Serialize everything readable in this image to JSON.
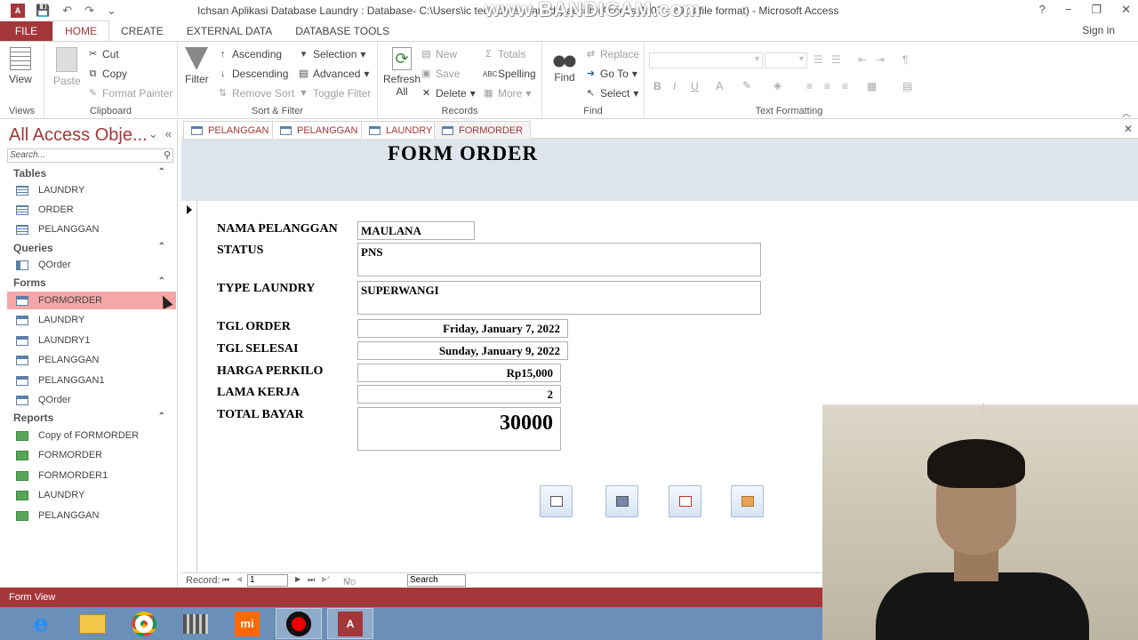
{
  "window": {
    "title": "Ichsan Aplikasi Database Laundry : Database- C:\\Users\\ic tech           dbase laundry.accdb (Access 2007 - 2013 file format) - Microsoft Access",
    "watermark": "www.BANDICAM.com",
    "app_icon": "A",
    "help": "?",
    "minimize": "−",
    "restore": "❐",
    "close": "✕",
    "qat_save": "💾",
    "qat_undo": "↶",
    "qat_redo": "↷",
    "qat_more": "⌄"
  },
  "ribbon_tabs": {
    "file": "FILE",
    "tabs": [
      "HOME",
      "CREATE",
      "EXTERNAL DATA",
      "DATABASE TOOLS"
    ],
    "active": "HOME",
    "signin": "Sign in"
  },
  "ribbon": {
    "views": {
      "label": "Views",
      "view": "View"
    },
    "clipboard": {
      "label": "Clipboard",
      "paste": "Paste",
      "cut": "Cut",
      "copy": "Copy",
      "format_painter": "Format Painter"
    },
    "sort_filter": {
      "label": "Sort & Filter",
      "filter": "Filter",
      "ascending": "Ascending",
      "descending": "Descending",
      "remove_sort": "Remove Sort",
      "selection": "Selection",
      "advanced": "Advanced",
      "toggle_filter": "Toggle Filter"
    },
    "records": {
      "label": "Records",
      "refresh": "Refresh",
      "refresh_all": "All",
      "new": "New",
      "save": "Save",
      "delete": "Delete",
      "totals": "Totals",
      "spelling": "Spelling",
      "more": "More"
    },
    "find": {
      "label": "Find",
      "find": "Find",
      "replace": "Replace",
      "goto": "Go To",
      "select": "Select"
    },
    "text_formatting": {
      "label": "Text Formatting",
      "bold": "B",
      "italic": "I",
      "underline": "U",
      "font_color": "A"
    }
  },
  "nav_pane": {
    "title": "All Access Obje...",
    "search_placeholder": "Search...",
    "sections": [
      {
        "name": "Tables",
        "items": [
          "LAUNDRY",
          "ORDER",
          "PELANGGAN"
        ]
      },
      {
        "name": "Queries",
        "items": [
          "QOrder"
        ]
      },
      {
        "name": "Forms",
        "items": [
          "FORMORDER",
          "LAUNDRY",
          "LAUNDRY1",
          "PELANGGAN",
          "PELANGGAN1",
          "QOrder"
        ]
      },
      {
        "name": "Reports",
        "items": [
          "Copy of FORMORDER",
          "FORMORDER",
          "FORMORDER1",
          "LAUNDRY",
          "PELANGGAN"
        ]
      }
    ],
    "selected": "FORMORDER"
  },
  "doc_tabs": [
    "PELANGGAN",
    "PELANGGAN",
    "LAUNDRY",
    "FORMORDER"
  ],
  "form": {
    "title": "FORM ORDER",
    "fields": [
      {
        "label": "NAMA PELANGGAN",
        "value": "MAULANA"
      },
      {
        "label": "STATUS",
        "value": "PNS"
      },
      {
        "label": "TYPE LAUNDRY",
        "value": "SUPERWANGI"
      },
      {
        "label": "TGL ORDER",
        "value": "Friday, January 7, 2022"
      },
      {
        "label": "TGL SELESAI",
        "value": "Sunday, January 9, 2022"
      },
      {
        "label": "HARGA PERKILO",
        "value": "Rp15,000"
      },
      {
        "label": "LAMA KERJA",
        "value": "2"
      },
      {
        "label": "TOTAL BAYAR",
        "value": "30000"
      }
    ]
  },
  "record_nav": {
    "label": "Record:",
    "current": "1",
    "first": "⏮",
    "prev": "◀",
    "next": "▶",
    "last": "⏭",
    "new": "▶*",
    "filter": "No Filter",
    "search": "Search"
  },
  "status": {
    "text": "Form View"
  },
  "colors": {
    "accent": "#a4373a",
    "form_header": "#dde4ec",
    "selected_nav": "#f5a6a6"
  }
}
